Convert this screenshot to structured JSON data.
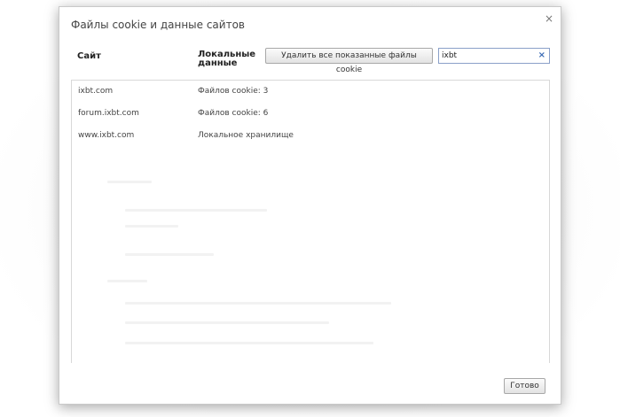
{
  "dialog": {
    "title": "Файлы cookie и данные сайтов",
    "close_label": "×"
  },
  "header": {
    "col_site": "Сайт",
    "col_local": "Локальные данные",
    "delete_all_label": "Удалить все показанные файлы cookie",
    "search_value": "ixbt",
    "search_clear_label": "×"
  },
  "rows": [
    {
      "site": "ixbt.com",
      "data": "Файлов cookie: 3"
    },
    {
      "site": "forum.ixbt.com",
      "data": "Файлов cookie: 6"
    },
    {
      "site": "www.ixbt.com",
      "data": "Локальное хранилище"
    }
  ],
  "footer": {
    "done_label": "Готово"
  },
  "colors": {
    "search_border": "#8aa0c8",
    "clear_icon": "#3b6bb5"
  }
}
